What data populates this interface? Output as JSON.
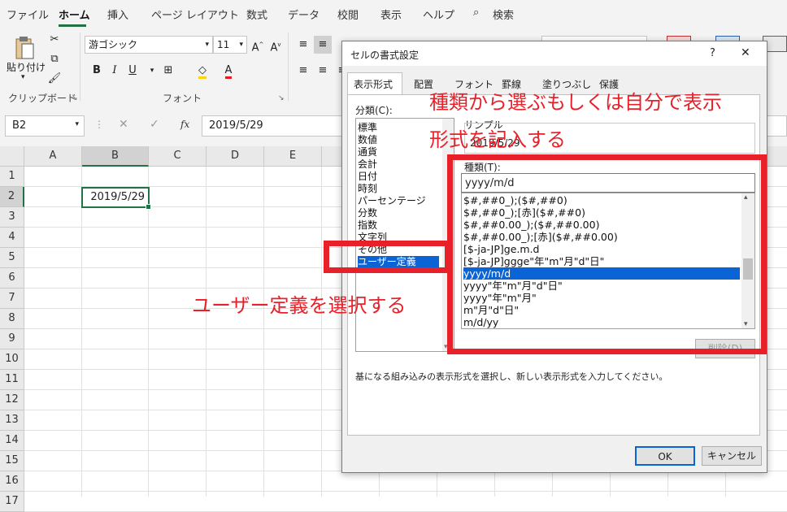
{
  "ribbon_tabs": [
    "ファイル",
    "ホーム",
    "挿入",
    "ページ レイアウト",
    "数式",
    "データ",
    "校閲",
    "表示",
    "ヘルプ",
    "検索"
  ],
  "clipboard": {
    "paste_label": "貼り付け",
    "group_label": "クリップボード"
  },
  "font": {
    "name": "游ゴシック",
    "size": "11",
    "group_label": "フォント",
    "bold": "B",
    "italic": "I",
    "underline": "U",
    "font_color_glyph": "A"
  },
  "name_box": "B2",
  "formula": {
    "fx": "fx",
    "value": "2019/5/29"
  },
  "columns": [
    "A",
    "B",
    "C",
    "D",
    "E"
  ],
  "rows": [
    "1",
    "2",
    "3",
    "4",
    "5",
    "6",
    "7",
    "8",
    "9",
    "10",
    "11",
    "12",
    "13",
    "14",
    "15",
    "16",
    "17"
  ],
  "cell_b2": "2019/5/29",
  "dialog": {
    "title": "セルの書式設定",
    "help": "?",
    "close": "X",
    "tabs": [
      "表示形式",
      "配置",
      "フォント",
      "罫線",
      "塗りつぶし",
      "保護"
    ],
    "category_label": "分類(C):",
    "categories": [
      "標準",
      "数値",
      "通貨",
      "会計",
      "日付",
      "時刻",
      "パーセンテージ",
      "分数",
      "指数",
      "文字列",
      "その他",
      "ユーザー定義"
    ],
    "selected_category": "ユーザー定義",
    "sample_label": "サンプル",
    "sample_value": "2019/5/29",
    "type_label": "種類(T):",
    "type_value": "yyyy/m/d",
    "formats": [
      "$#,##0_);($#,##0)",
      "$#,##0_);[赤]($#,##0)",
      "$#,##0.00_);($#,##0.00)",
      "$#,##0.00_);[赤]($#,##0.00)",
      "[$-ja-JP]ge.m.d",
      "[$-ja-JP]ggge\"年\"m\"月\"d\"日\"",
      "yyyy/m/d",
      "yyyy\"年\"m\"月\"d\"日\"",
      "yyyy\"年\"m\"月\"",
      "m\"月\"d\"日\"",
      "m/d/yy"
    ],
    "selected_format": "yyyy/m/d",
    "delete_button": "削除(D)",
    "description": "基になる組み込みの表示形式を選択し、新しい表示形式を入力してください。",
    "ok": "OK",
    "cancel": "キャンセル"
  },
  "annotations": {
    "top_line1": "種類から選ぶもしくは自分で表示",
    "top_line2": "形式を記入する",
    "left": "ユーザー定義を選択する",
    "color": "#e8202a"
  },
  "colors": {
    "excel_green": "#217346",
    "selection_blue": "#0a64d6"
  }
}
